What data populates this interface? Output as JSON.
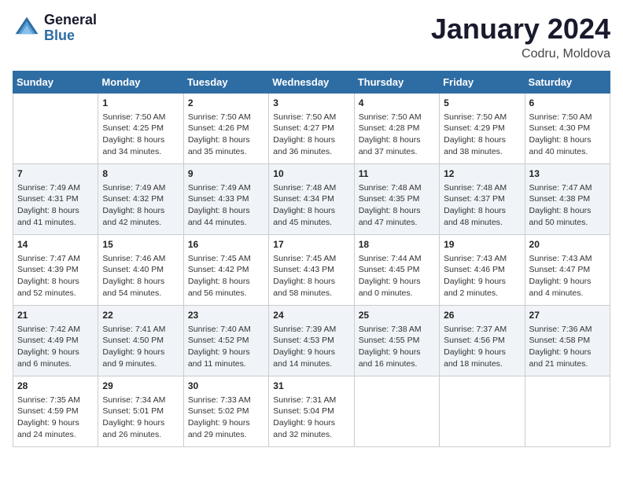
{
  "header": {
    "logo_line1": "General",
    "logo_line2": "Blue",
    "month_year": "January 2024",
    "location": "Codru, Moldova"
  },
  "days_of_week": [
    "Sunday",
    "Monday",
    "Tuesday",
    "Wednesday",
    "Thursday",
    "Friday",
    "Saturday"
  ],
  "weeks": [
    [
      {
        "day": "",
        "sunrise": "",
        "sunset": "",
        "daylight": ""
      },
      {
        "day": "1",
        "sunrise": "Sunrise: 7:50 AM",
        "sunset": "Sunset: 4:25 PM",
        "daylight": "Daylight: 8 hours and 34 minutes."
      },
      {
        "day": "2",
        "sunrise": "Sunrise: 7:50 AM",
        "sunset": "Sunset: 4:26 PM",
        "daylight": "Daylight: 8 hours and 35 minutes."
      },
      {
        "day": "3",
        "sunrise": "Sunrise: 7:50 AM",
        "sunset": "Sunset: 4:27 PM",
        "daylight": "Daylight: 8 hours and 36 minutes."
      },
      {
        "day": "4",
        "sunrise": "Sunrise: 7:50 AM",
        "sunset": "Sunset: 4:28 PM",
        "daylight": "Daylight: 8 hours and 37 minutes."
      },
      {
        "day": "5",
        "sunrise": "Sunrise: 7:50 AM",
        "sunset": "Sunset: 4:29 PM",
        "daylight": "Daylight: 8 hours and 38 minutes."
      },
      {
        "day": "6",
        "sunrise": "Sunrise: 7:50 AM",
        "sunset": "Sunset: 4:30 PM",
        "daylight": "Daylight: 8 hours and 40 minutes."
      }
    ],
    [
      {
        "day": "7",
        "sunrise": "Sunrise: 7:49 AM",
        "sunset": "Sunset: 4:31 PM",
        "daylight": "Daylight: 8 hours and 41 minutes."
      },
      {
        "day": "8",
        "sunrise": "Sunrise: 7:49 AM",
        "sunset": "Sunset: 4:32 PM",
        "daylight": "Daylight: 8 hours and 42 minutes."
      },
      {
        "day": "9",
        "sunrise": "Sunrise: 7:49 AM",
        "sunset": "Sunset: 4:33 PM",
        "daylight": "Daylight: 8 hours and 44 minutes."
      },
      {
        "day": "10",
        "sunrise": "Sunrise: 7:48 AM",
        "sunset": "Sunset: 4:34 PM",
        "daylight": "Daylight: 8 hours and 45 minutes."
      },
      {
        "day": "11",
        "sunrise": "Sunrise: 7:48 AM",
        "sunset": "Sunset: 4:35 PM",
        "daylight": "Daylight: 8 hours and 47 minutes."
      },
      {
        "day": "12",
        "sunrise": "Sunrise: 7:48 AM",
        "sunset": "Sunset: 4:37 PM",
        "daylight": "Daylight: 8 hours and 48 minutes."
      },
      {
        "day": "13",
        "sunrise": "Sunrise: 7:47 AM",
        "sunset": "Sunset: 4:38 PM",
        "daylight": "Daylight: 8 hours and 50 minutes."
      }
    ],
    [
      {
        "day": "14",
        "sunrise": "Sunrise: 7:47 AM",
        "sunset": "Sunset: 4:39 PM",
        "daylight": "Daylight: 8 hours and 52 minutes."
      },
      {
        "day": "15",
        "sunrise": "Sunrise: 7:46 AM",
        "sunset": "Sunset: 4:40 PM",
        "daylight": "Daylight: 8 hours and 54 minutes."
      },
      {
        "day": "16",
        "sunrise": "Sunrise: 7:45 AM",
        "sunset": "Sunset: 4:42 PM",
        "daylight": "Daylight: 8 hours and 56 minutes."
      },
      {
        "day": "17",
        "sunrise": "Sunrise: 7:45 AM",
        "sunset": "Sunset: 4:43 PM",
        "daylight": "Daylight: 8 hours and 58 minutes."
      },
      {
        "day": "18",
        "sunrise": "Sunrise: 7:44 AM",
        "sunset": "Sunset: 4:45 PM",
        "daylight": "Daylight: 9 hours and 0 minutes."
      },
      {
        "day": "19",
        "sunrise": "Sunrise: 7:43 AM",
        "sunset": "Sunset: 4:46 PM",
        "daylight": "Daylight: 9 hours and 2 minutes."
      },
      {
        "day": "20",
        "sunrise": "Sunrise: 7:43 AM",
        "sunset": "Sunset: 4:47 PM",
        "daylight": "Daylight: 9 hours and 4 minutes."
      }
    ],
    [
      {
        "day": "21",
        "sunrise": "Sunrise: 7:42 AM",
        "sunset": "Sunset: 4:49 PM",
        "daylight": "Daylight: 9 hours and 6 minutes."
      },
      {
        "day": "22",
        "sunrise": "Sunrise: 7:41 AM",
        "sunset": "Sunset: 4:50 PM",
        "daylight": "Daylight: 9 hours and 9 minutes."
      },
      {
        "day": "23",
        "sunrise": "Sunrise: 7:40 AM",
        "sunset": "Sunset: 4:52 PM",
        "daylight": "Daylight: 9 hours and 11 minutes."
      },
      {
        "day": "24",
        "sunrise": "Sunrise: 7:39 AM",
        "sunset": "Sunset: 4:53 PM",
        "daylight": "Daylight: 9 hours and 14 minutes."
      },
      {
        "day": "25",
        "sunrise": "Sunrise: 7:38 AM",
        "sunset": "Sunset: 4:55 PM",
        "daylight": "Daylight: 9 hours and 16 minutes."
      },
      {
        "day": "26",
        "sunrise": "Sunrise: 7:37 AM",
        "sunset": "Sunset: 4:56 PM",
        "daylight": "Daylight: 9 hours and 18 minutes."
      },
      {
        "day": "27",
        "sunrise": "Sunrise: 7:36 AM",
        "sunset": "Sunset: 4:58 PM",
        "daylight": "Daylight: 9 hours and 21 minutes."
      }
    ],
    [
      {
        "day": "28",
        "sunrise": "Sunrise: 7:35 AM",
        "sunset": "Sunset: 4:59 PM",
        "daylight": "Daylight: 9 hours and 24 minutes."
      },
      {
        "day": "29",
        "sunrise": "Sunrise: 7:34 AM",
        "sunset": "Sunset: 5:01 PM",
        "daylight": "Daylight: 9 hours and 26 minutes."
      },
      {
        "day": "30",
        "sunrise": "Sunrise: 7:33 AM",
        "sunset": "Sunset: 5:02 PM",
        "daylight": "Daylight: 9 hours and 29 minutes."
      },
      {
        "day": "31",
        "sunrise": "Sunrise: 7:31 AM",
        "sunset": "Sunset: 5:04 PM",
        "daylight": "Daylight: 9 hours and 32 minutes."
      },
      {
        "day": "",
        "sunrise": "",
        "sunset": "",
        "daylight": ""
      },
      {
        "day": "",
        "sunrise": "",
        "sunset": "",
        "daylight": ""
      },
      {
        "day": "",
        "sunrise": "",
        "sunset": "",
        "daylight": ""
      }
    ]
  ]
}
